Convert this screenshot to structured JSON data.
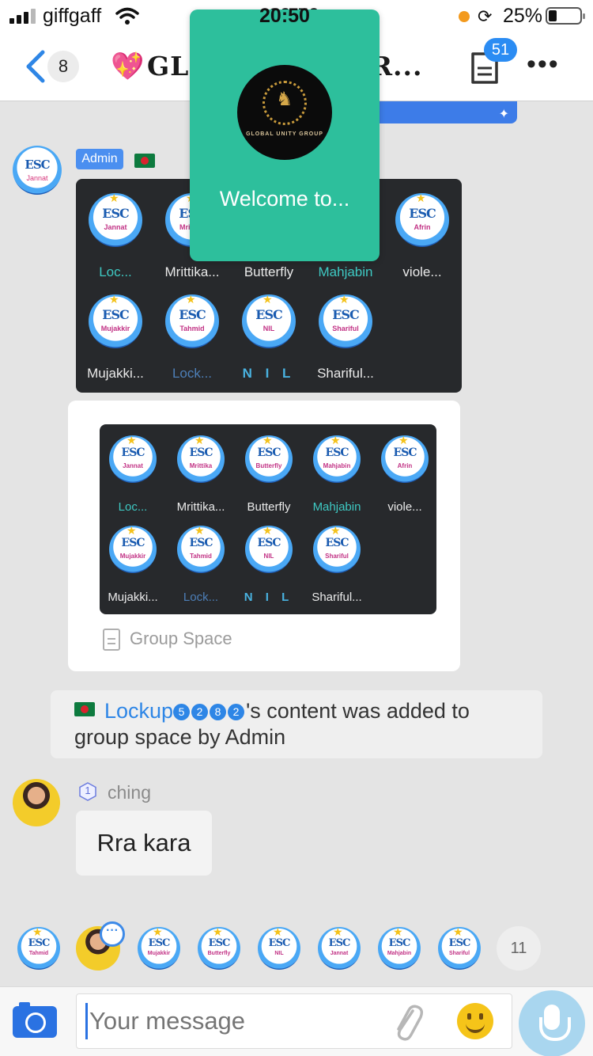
{
  "status_bar": {
    "carrier": "giffgaff",
    "time": "20:50",
    "battery_percent": "25%",
    "battery_level": 0.25
  },
  "header": {
    "back_count": "8",
    "title_visible": "GL",
    "title_end": "GR...",
    "doc_badge": "51"
  },
  "popup": {
    "logo_text": "GLOBAL UNITY GROUP",
    "welcome": "Welcome to..."
  },
  "admin_message": {
    "role": "Admin",
    "members_row1": [
      "Loc...",
      "Mrittika...",
      "Butterfly",
      "Mahjabin",
      "viole..."
    ],
    "members_row2": [
      "Mujakki...",
      "Lock...",
      "N I L",
      "Shariful..."
    ]
  },
  "group_space_card": {
    "members_row1": [
      "Loc...",
      "Mrittika...",
      "Butterfly",
      "Mahjabin",
      "viole..."
    ],
    "members_row2": [
      "Mujakki...",
      "Lock...",
      "N I L",
      "Shariful..."
    ],
    "label": "Group Space"
  },
  "avatar_labels": [
    "Jannat",
    "Mrittika",
    "Butterfly",
    "Mahjabin",
    "Afrin",
    "Mujakkir",
    "Tahmid",
    "NIL",
    "Shariful"
  ],
  "avatar_esc": "ESC",
  "notice": {
    "user": "Lockup",
    "digits": [
      "5",
      "2",
      "8",
      "2"
    ],
    "text": "'s content was added to group space by Admin"
  },
  "chat": {
    "level": "1",
    "sender": "ching",
    "message": "Rra kara"
  },
  "viewers": {
    "labels": [
      "Tahmid",
      "ching",
      "Mujakkir",
      "Butterfly",
      "NIL",
      "Jannat",
      "Mahjabin",
      "Shariful"
    ],
    "more_count": "11"
  },
  "input": {
    "placeholder": "Your message"
  },
  "colors": {
    "accent": "#2b8cf3",
    "popup": "#2dbf9c",
    "admin_tag": "#4b8ff0"
  }
}
